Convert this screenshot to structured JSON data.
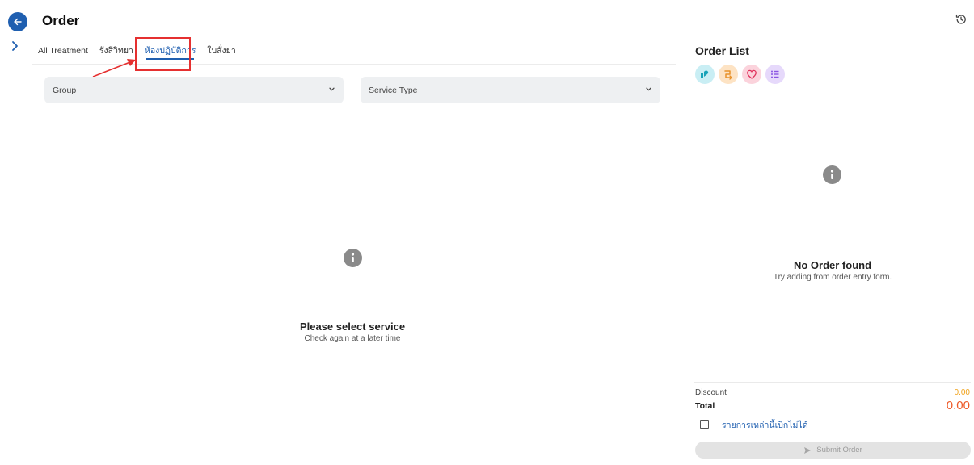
{
  "header": {
    "title": "Order"
  },
  "tabs": [
    {
      "label": "All Treatment"
    },
    {
      "label": "รังสีวิทยา"
    },
    {
      "label": "ห้องปฏิบัติการ"
    },
    {
      "label": "ใบสั่งยา"
    }
  ],
  "active_tab": 2,
  "filters": {
    "group_placeholder": "Group",
    "service_type_placeholder": "Service Type"
  },
  "main_empty": {
    "title": "Please select service",
    "subtitle": "Check again at a later time"
  },
  "order_list": {
    "title": "Order List",
    "filter_icons": [
      "treatment-icon",
      "procedure-icon",
      "heart-icon",
      "list-icon"
    ],
    "empty_title": "No Order found",
    "empty_subtitle": "Try adding from order entry form."
  },
  "totals": {
    "discount_label": "Discount",
    "discount_value": "0.00",
    "total_label": "Total",
    "total_value": "0.00"
  },
  "non_claimable_label": "รายการเหล่านี้เบิกไม่ได้",
  "submit_label": "Submit Order",
  "colors": {
    "primary": "#1f5fb0",
    "highlight": "#e53030",
    "discount": "#f0a21a",
    "total": "#ee5a28"
  }
}
